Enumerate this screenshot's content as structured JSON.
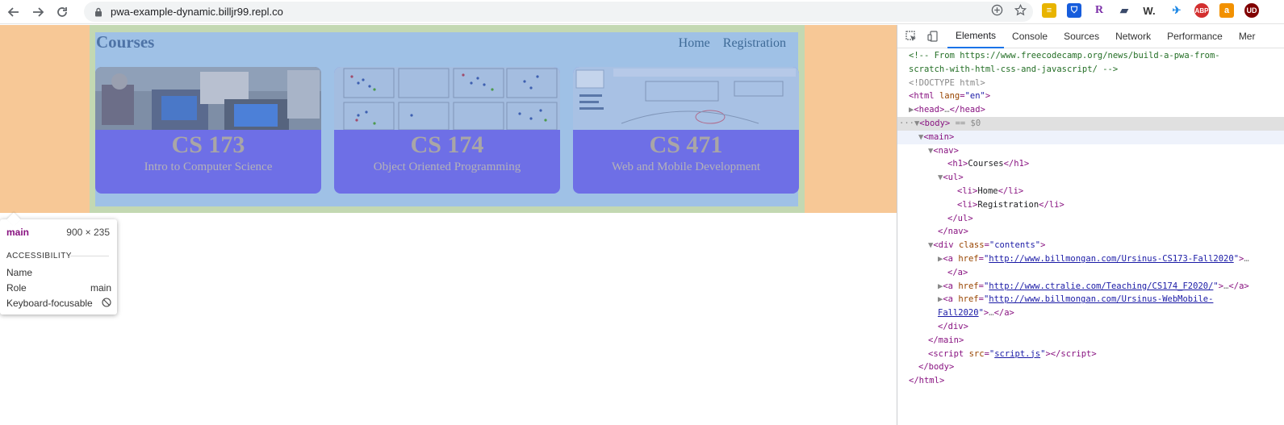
{
  "browser": {
    "url": "pwa-example-dynamic.billjr99.repl.co",
    "icons": [
      "back-arrow-icon",
      "forward-arrow-icon",
      "reload-icon",
      "lock-icon",
      "add-to-home-icon",
      "star-icon"
    ]
  },
  "page": {
    "title": "Courses",
    "nav": [
      "Home",
      "Registration"
    ],
    "cards": [
      {
        "code": "CS 173",
        "name": "Intro to Computer Science"
      },
      {
        "code": "CS 174",
        "name": "Object Oriented Programming"
      },
      {
        "code": "CS 471",
        "name": "Web and Mobile Development"
      }
    ]
  },
  "tooltip": {
    "tag": "main",
    "size": "900 × 235",
    "section": "ACCESSIBILITY",
    "rows": [
      {
        "label": "Name",
        "value": ""
      },
      {
        "label": "Role",
        "value": "main"
      },
      {
        "label": "Keyboard-focusable",
        "value": ""
      }
    ]
  },
  "devtools": {
    "tabs": [
      "Elements",
      "Console",
      "Sources",
      "Network",
      "Performance",
      "Mer"
    ],
    "active_tab": "Elements",
    "dom": {
      "comment_1": "<!-- From https://www.freecodecamp.org/news/build-a-pwa-from-",
      "comment_2": "scratch-with-html-css-and-javascript/ -->",
      "doctype": "<!DOCTYPE html>",
      "html_open": "html",
      "lang_attr": "lang",
      "lang_val": "\"en\"",
      "head": "head",
      "body": "body",
      "body_marker": "== $0",
      "main": "main",
      "nav": "nav",
      "h1": "h1",
      "h1_text": "Courses",
      "ul": "ul",
      "li": "li",
      "li1": "Home",
      "li2": "Registration",
      "div": "div",
      "class_attr": "class",
      "class_val": "\"contents\"",
      "a": "a",
      "href": "href",
      "link1": "http://www.billmongan.com/Ursinus-CS173-Fall2020",
      "link2": "http://www.ctralie.com/Teaching/CS174_F2020/",
      "link3a": "http://www.billmongan.com/Ursinus-WebMobile-",
      "link3b": "Fall2020",
      "script": "script",
      "src": "src",
      "src_val": "script.js"
    }
  }
}
